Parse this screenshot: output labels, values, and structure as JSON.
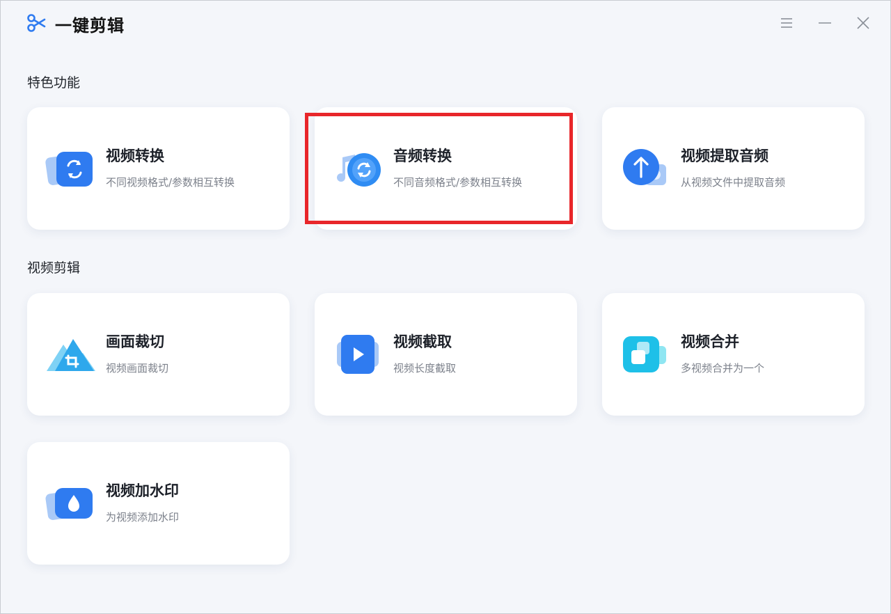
{
  "app": {
    "title": "一键剪辑",
    "logo_icon": "scissors-icon",
    "accent_color": "#2f7bf0"
  },
  "window_controls": {
    "menu_icon": "menu-icon",
    "minimize_icon": "minimize-icon",
    "close_icon": "close-icon"
  },
  "sections": {
    "featured": "特色功能",
    "video_edit": "视频剪辑"
  },
  "cards": {
    "video_convert": {
      "label": "视频转换",
      "desc": "不同视频格式/参数相互转换",
      "icon": "video-convert-icon"
    },
    "audio_convert": {
      "label": "音频转换",
      "desc": "不同音频格式/参数相互转换",
      "icon": "audio-convert-icon"
    },
    "extract_audio": {
      "label": "视频提取音频",
      "desc": "从视频文件中提取音频",
      "icon": "extract-audio-icon"
    },
    "crop": {
      "label": "画面裁切",
      "desc": "视频画面裁切",
      "icon": "crop-icon"
    },
    "trim": {
      "label": "视频截取",
      "desc": "视频长度截取",
      "icon": "video-trim-icon"
    },
    "merge": {
      "label": "视频合并",
      "desc": "多视频合并为一个",
      "icon": "video-merge-icon"
    },
    "watermark": {
      "label": "视频加水印",
      "desc": "为视频添加水印",
      "icon": "watermark-icon"
    }
  },
  "highlight": {
    "target": "audio_convert",
    "color": "#e8262a"
  }
}
